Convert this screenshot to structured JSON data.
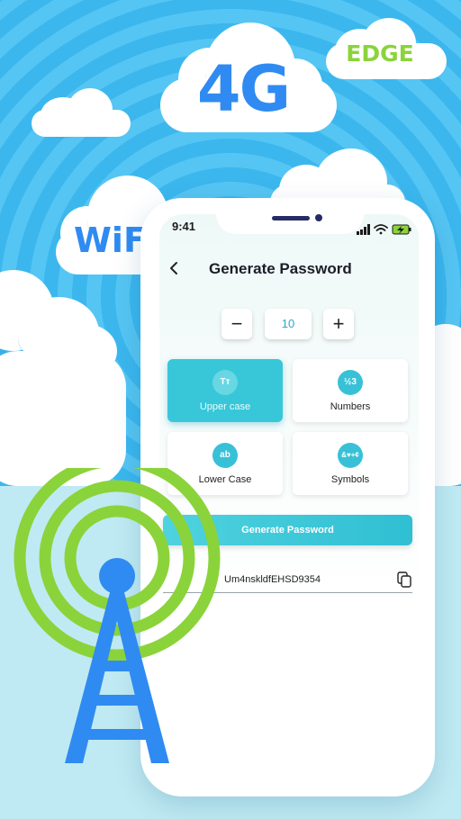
{
  "badges": {
    "network_4g": "4G",
    "network_edge": "EDGE",
    "wifi": "WiFi"
  },
  "status_bar": {
    "time": "9:41"
  },
  "header": {
    "title": "Generate Password"
  },
  "length_stepper": {
    "minus": "−",
    "value": "10",
    "plus": "+"
  },
  "options": [
    {
      "icon": "Tт",
      "label": "Upper case",
      "selected": true
    },
    {
      "icon": "½3",
      "label": "Numbers",
      "selected": false
    },
    {
      "icon": "ab",
      "label": "Lower Case",
      "selected": false
    },
    {
      "icon": "&♥+¢",
      "label": "Symbols",
      "selected": false
    }
  ],
  "generate_button": {
    "label": "Generate Password"
  },
  "result": {
    "password": "Um4nskldfEHSD9354"
  },
  "colors": {
    "accent": "#38c7d8",
    "blue": "#2f8bf1",
    "green": "#8bd33a",
    "sky": "#3bb7ee"
  }
}
